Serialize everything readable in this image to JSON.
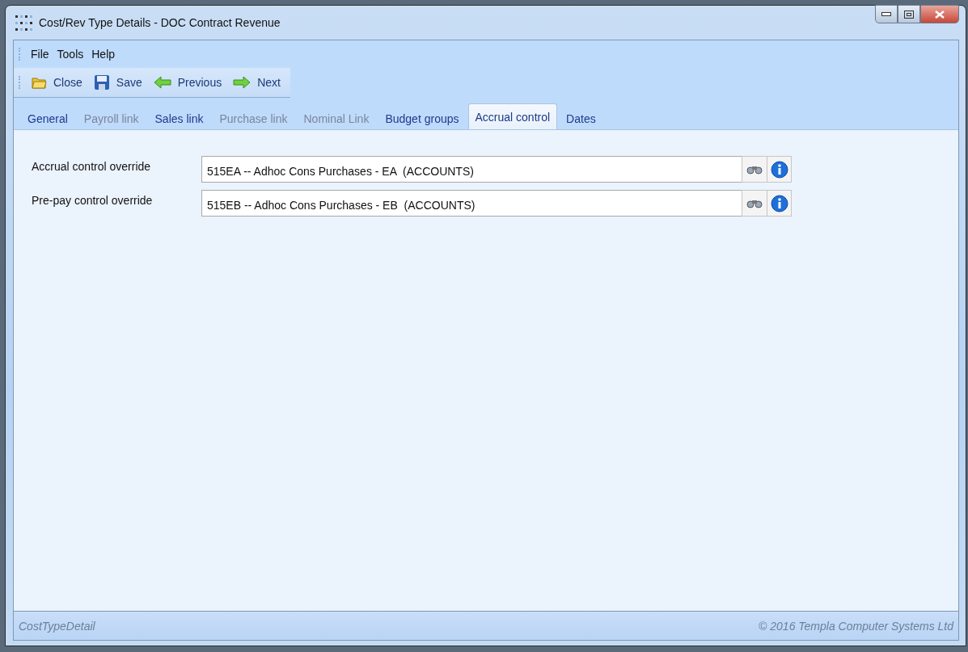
{
  "window": {
    "title": "Cost/Rev Type Details - DOC Contract Revenue"
  },
  "menu": [
    "File",
    "Tools",
    "Help"
  ],
  "toolbar": [
    {
      "label": "Close",
      "kind": "folder"
    },
    {
      "label": "Save",
      "kind": "disk"
    },
    {
      "label": "Previous",
      "kind": "back"
    },
    {
      "label": "Next",
      "kind": "forward"
    }
  ],
  "tabs": [
    {
      "label": "General",
      "selected": false,
      "disabled": false
    },
    {
      "label": "Payroll link",
      "selected": false,
      "disabled": true
    },
    {
      "label": "Sales link",
      "selected": false,
      "disabled": false
    },
    {
      "label": "Purchase link",
      "selected": false,
      "disabled": true
    },
    {
      "label": "Nominal Link",
      "selected": false,
      "disabled": true
    },
    {
      "label": "Budget groups",
      "selected": false,
      "disabled": false
    },
    {
      "label": "Accrual control",
      "selected": true,
      "disabled": false
    },
    {
      "label": "Dates",
      "selected": false,
      "disabled": false
    }
  ],
  "fields": [
    {
      "label": "Accrual control override",
      "value": "515EA -- Adhoc Cons Purchases - EA  (ACCOUNTS)"
    },
    {
      "label": "Pre-pay control override",
      "value": "515EB -- Adhoc Cons Purchases - EB  (ACCOUNTS)"
    }
  ],
  "status_bar": {
    "left": "CostTypeDetail",
    "right": "© 2016 Templa Computer Systems Ltd"
  }
}
